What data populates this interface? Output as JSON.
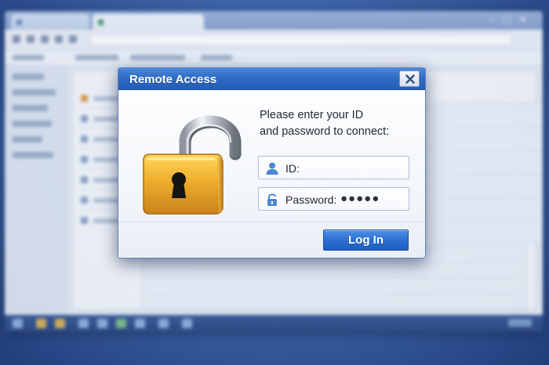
{
  "dialog": {
    "title": "Remote Access",
    "prompt_line1": "Please enter your ID",
    "prompt_line2": "and password to connect:",
    "id_label": "ID:",
    "id_value": "",
    "password_label": "Password:",
    "password_value": "●●●●●",
    "login_label": "Log In"
  },
  "colors": {
    "titlebar": "#2f6cc5",
    "button": "#2c6fd1",
    "lock_body": "#e8a628",
    "background": "#3f66aa"
  },
  "icons": {
    "close": "close-icon",
    "user": "user-icon",
    "lock_small": "padlock-small-icon",
    "lock_large": "open-padlock-icon"
  }
}
